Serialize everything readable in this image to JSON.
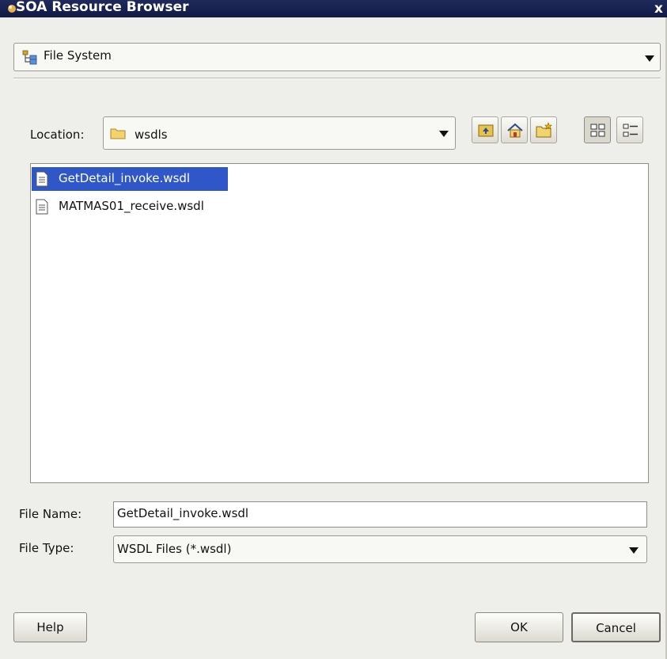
{
  "window": {
    "title": "SOA Resource Browser",
    "close_symbol": "x"
  },
  "source": {
    "selected": "File System",
    "icon": "file-system-tree-icon"
  },
  "location": {
    "label": "Location:",
    "value": "wsdls",
    "icon": "folder-icon"
  },
  "toolbar": {
    "buttons": [
      "up-folder-icon",
      "home-icon",
      "new-folder-icon",
      "icon-view-icon",
      "list-view-icon"
    ]
  },
  "files": [
    {
      "name": "GetDetail_invoke.wsdl",
      "selected": true
    },
    {
      "name": "MATMAS01_receive.wsdl",
      "selected": false
    }
  ],
  "file_name": {
    "label": "File Name:",
    "value": "GetDetail_invoke.wsdl"
  },
  "file_type": {
    "label": "File Type:",
    "value": "WSDL Files (*.wsdl)"
  },
  "buttons": {
    "help": "Help",
    "ok": "OK",
    "cancel": "Cancel"
  },
  "colors": {
    "titlebar": "#1a2352",
    "selection": "#2f57c9",
    "background": "#eeeeea"
  }
}
